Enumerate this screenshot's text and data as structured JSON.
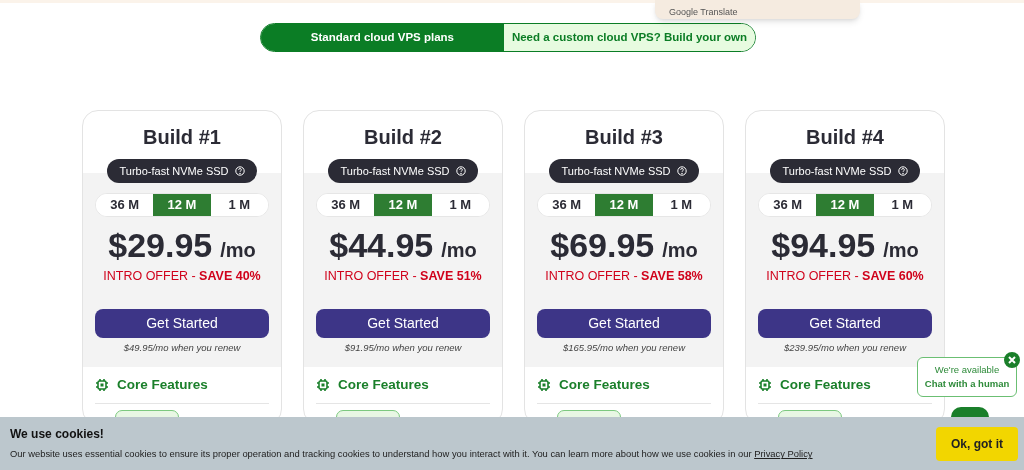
{
  "translate_popup": {
    "label": "Google Translate"
  },
  "plan_toggle": [
    {
      "label": "Standard cloud VPS plans",
      "selected": true
    },
    {
      "label": "Need a custom cloud VPS? Build your own",
      "selected": false
    }
  ],
  "plans": [
    {
      "title": "Build #1",
      "storage": "Turbo-fast NVMe SSD",
      "terms": [
        {
          "label": "36 M",
          "selected": false
        },
        {
          "label": "12 M",
          "selected": true
        },
        {
          "label": "1 M",
          "selected": false
        }
      ],
      "price": "$29.95",
      "unit": "/mo",
      "offer": "INTRO OFFER - ",
      "save": "SAVE 40%",
      "button": "Get Started",
      "renew": "$49.95/mo when you renew",
      "features": "Core Features"
    },
    {
      "title": "Build #2",
      "storage": "Turbo-fast NVMe SSD",
      "terms": [
        {
          "label": "36 M",
          "selected": false
        },
        {
          "label": "12 M",
          "selected": true
        },
        {
          "label": "1 M",
          "selected": false
        }
      ],
      "price": "$44.95",
      "unit": "/mo",
      "offer": "INTRO OFFER - ",
      "save": "SAVE 51%",
      "button": "Get Started",
      "renew": "$91.95/mo when you renew",
      "features": "Core Features"
    },
    {
      "title": "Build #3",
      "storage": "Turbo-fast NVMe SSD",
      "terms": [
        {
          "label": "36 M",
          "selected": false
        },
        {
          "label": "12 M",
          "selected": true
        },
        {
          "label": "1 M",
          "selected": false
        }
      ],
      "price": "$69.95",
      "unit": "/mo",
      "offer": "INTRO OFFER - ",
      "save": "SAVE 58%",
      "button": "Get Started",
      "renew": "$165.95/mo when you renew",
      "features": "Core Features"
    },
    {
      "title": "Build #4",
      "storage": "Turbo-fast NVMe SSD",
      "terms": [
        {
          "label": "36 M",
          "selected": false
        },
        {
          "label": "12 M",
          "selected": true
        },
        {
          "label": "1 M",
          "selected": false
        }
      ],
      "price": "$94.95",
      "unit": "/mo",
      "offer": "INTRO OFFER - ",
      "save": "SAVE 60%",
      "button": "Get Started",
      "renew": "$239.95/mo when you renew",
      "features": "Core Features"
    }
  ],
  "chat": {
    "status": "We're available",
    "action": "Chat with a human"
  },
  "cookies": {
    "title": "We use cookies!",
    "text": "Our website uses essential cookies to ensure its proper operation and tracking cookies to understand how you interact with it. You can learn more about how we use cookies in our ",
    "link": "Privacy Policy",
    "button": "Ok, got it"
  }
}
